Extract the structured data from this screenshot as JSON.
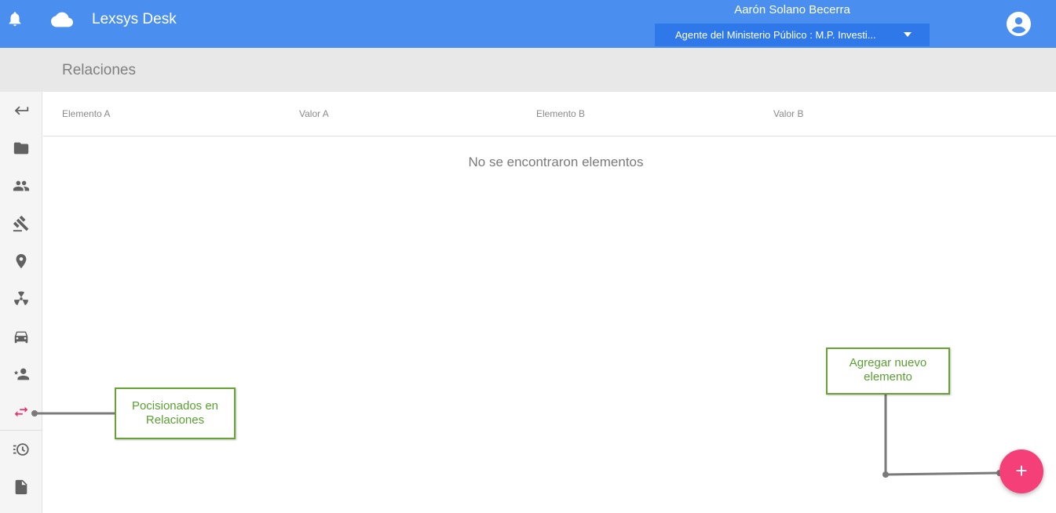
{
  "header": {
    "app_title": "Lexsys Desk",
    "user_name": "Aarón Solano Becerra",
    "role_selected": "Agente del Ministerio Público : M.P. Investi...",
    "bell_icon": "notifications-bell-icon",
    "cloud_icon": "cloud-icon",
    "account_icon": "account-circle-icon"
  },
  "page": {
    "title": "Relaciones"
  },
  "sidebar": {
    "items": [
      {
        "icon": "back-arrow-icon",
        "active": false
      },
      {
        "icon": "folder-icon",
        "active": false
      },
      {
        "icon": "people-icon",
        "active": false
      },
      {
        "icon": "gavel-icon",
        "active": false
      },
      {
        "icon": "location-pin-icon",
        "active": false
      },
      {
        "icon": "radiation-icon",
        "active": false
      },
      {
        "icon": "car-icon",
        "active": false
      },
      {
        "icon": "starred-person-icon",
        "active": false
      },
      {
        "icon": "swap-arrows-icon",
        "active": true
      },
      {
        "icon": "history-icon",
        "active": false
      },
      {
        "icon": "document-icon",
        "active": false
      }
    ]
  },
  "table": {
    "columns": [
      "Elemento A",
      "Valor A",
      "Elemento B",
      "Valor B"
    ],
    "rows": [],
    "empty_message": "No se encontraron elementos"
  },
  "fab": {
    "label": "+"
  },
  "annotations": {
    "left_callout": "Pocisionados en Relaciones",
    "right_callout": "Agregar nuevo elemento"
  },
  "colors": {
    "topbar": "#4a8ff0",
    "role_select": "#2f78ea",
    "accent": "#f43f78",
    "callout_green": "#68a235"
  }
}
